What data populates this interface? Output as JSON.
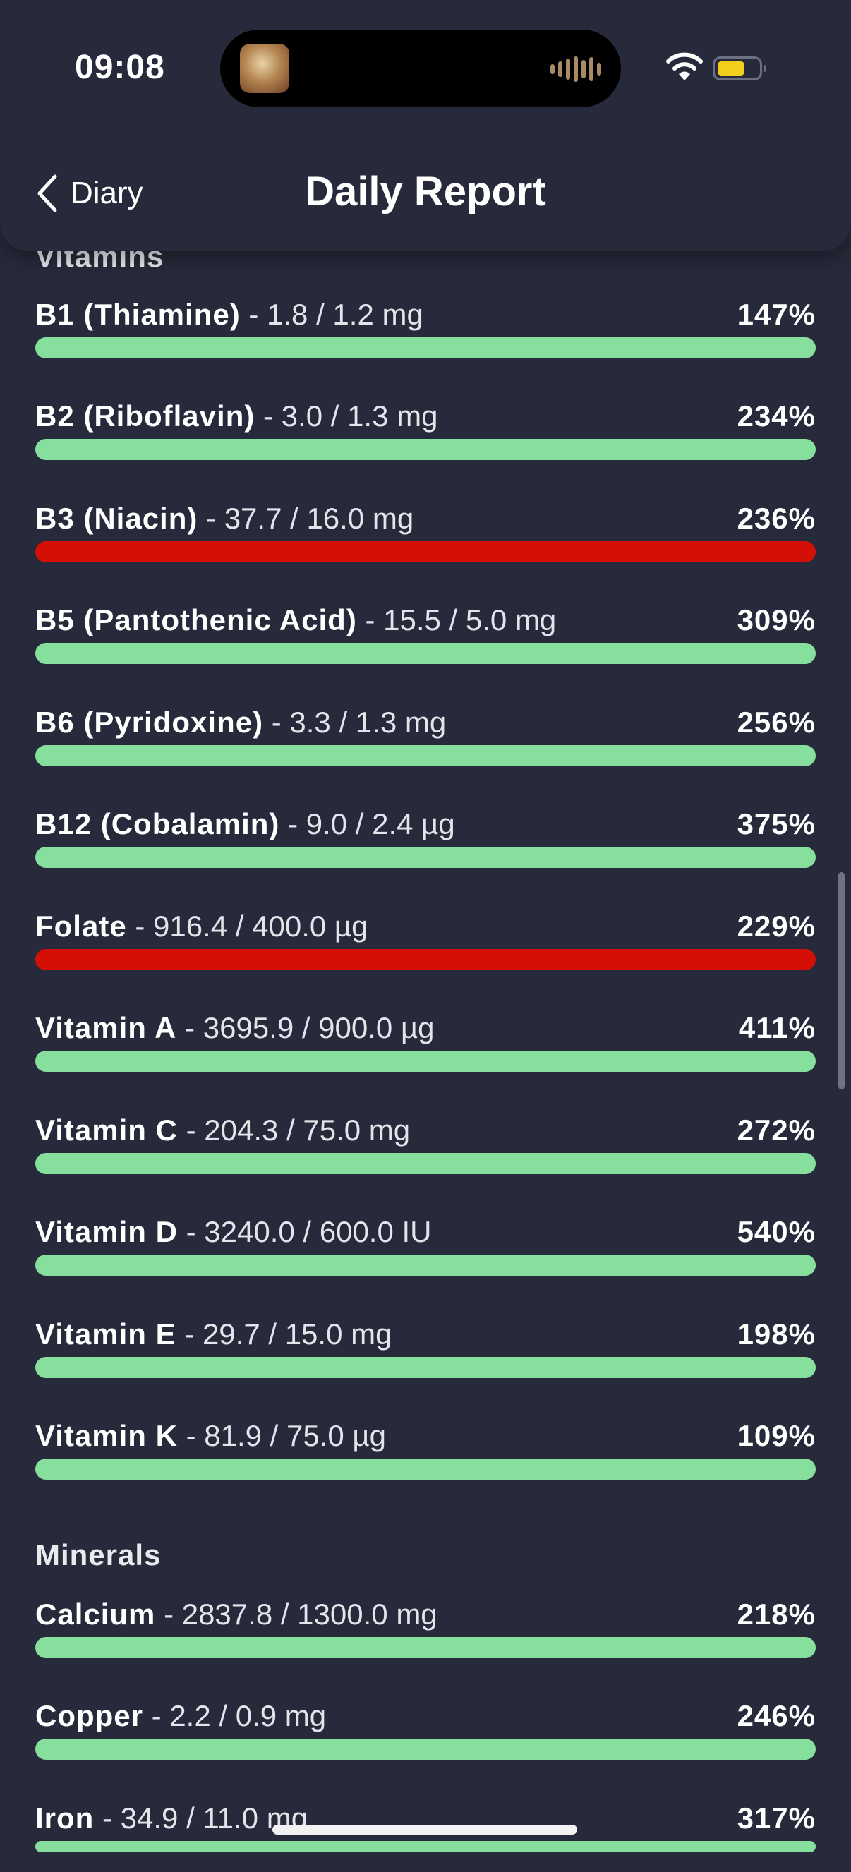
{
  "status_bar": {
    "time": "09:08"
  },
  "nav": {
    "back_label": "Diary",
    "title": "Daily Report"
  },
  "sections": {
    "vitamins": {
      "heading": "Vitamins",
      "items": [
        {
          "name": "B1 (Thiamine)",
          "amount": "- 1.8 / 1.2 mg",
          "percent": "147%",
          "bar_color": "#86df9d"
        },
        {
          "name": "B2 (Riboflavin)",
          "amount": "- 3.0 / 1.3 mg",
          "percent": "234%",
          "bar_color": "#86df9d"
        },
        {
          "name": "B3 (Niacin)",
          "amount": "- 37.7 / 16.0 mg",
          "percent": "236%",
          "bar_color": "#d40f06"
        },
        {
          "name": "B5 (Pantothenic Acid)",
          "amount": "- 15.5 / 5.0 mg",
          "percent": "309%",
          "bar_color": "#86df9d"
        },
        {
          "name": "B6 (Pyridoxine)",
          "amount": "- 3.3 / 1.3 mg",
          "percent": "256%",
          "bar_color": "#86df9d"
        },
        {
          "name": "B12 (Cobalamin)",
          "amount": "- 9.0 / 2.4 µg",
          "percent": "375%",
          "bar_color": "#86df9d"
        },
        {
          "name": "Folate",
          "amount": "- 916.4 / 400.0 µg",
          "percent": "229%",
          "bar_color": "#d40f06"
        },
        {
          "name": "Vitamin A",
          "amount": "- 3695.9 / 900.0 µg",
          "percent": "411%",
          "bar_color": "#86df9d"
        },
        {
          "name": "Vitamin C",
          "amount": "- 204.3 / 75.0 mg",
          "percent": "272%",
          "bar_color": "#86df9d"
        },
        {
          "name": "Vitamin D",
          "amount": "- 3240.0 / 600.0 IU",
          "percent": "540%",
          "bar_color": "#86df9d"
        },
        {
          "name": "Vitamin E",
          "amount": "- 29.7 / 15.0 mg",
          "percent": "198%",
          "bar_color": "#86df9d"
        },
        {
          "name": "Vitamin K",
          "amount": "- 81.9 / 75.0 µg",
          "percent": "109%",
          "bar_color": "#86df9d"
        }
      ]
    },
    "minerals": {
      "heading": "Minerals",
      "items": [
        {
          "name": "Calcium",
          "amount": "- 2837.8 / 1300.0 mg",
          "percent": "218%",
          "bar_color": "#86df9d"
        },
        {
          "name": "Copper",
          "amount": "- 2.2 / 0.9 mg",
          "percent": "246%",
          "bar_color": "#86df9d"
        },
        {
          "name": "Iron",
          "amount": "- 34.9 / 11.0 mg",
          "percent": "317%",
          "bar_color": "#86df9d"
        }
      ]
    }
  },
  "colors": {
    "background": "#272a3a",
    "ok": "#86df9d",
    "over_limit": "#d40f06"
  },
  "icons": [
    "wifi-icon",
    "battery-icon",
    "chevron-left-icon"
  ]
}
